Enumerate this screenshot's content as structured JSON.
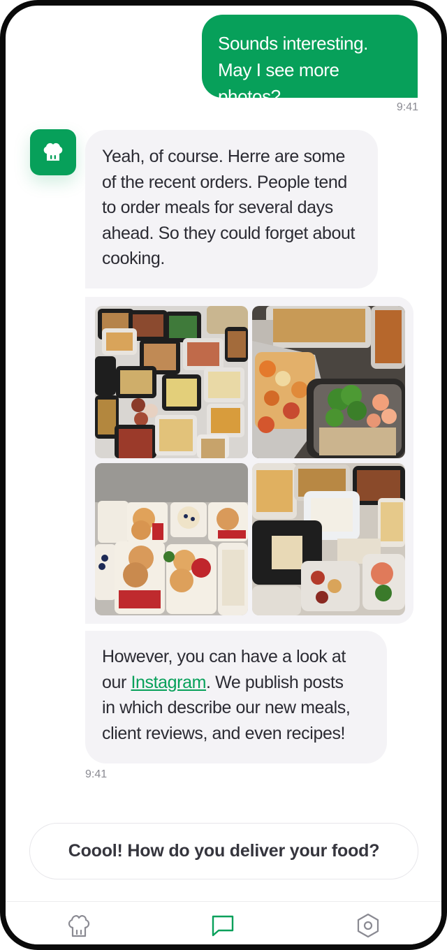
{
  "messages": {
    "outgoing": {
      "line1": "Sounds interesting.",
      "line2": "May I see more photos?",
      "time": "9:41"
    },
    "incoming_first": {
      "lines": [
        "Yeah, of course. Herre are some",
        "of the recent orders. People tend",
        "to order meals for several days",
        "ahead. So they could forget about",
        "cooking."
      ]
    },
    "incoming_last": {
      "line1": "However, you can have a look at",
      "line2_prefix": "our ",
      "link": "Instagram",
      "line2_suffix": ". We publish posts",
      "line3": "in which describe our new meals,",
      "line4": "client reviews, and even recipes!",
      "time": "9:41"
    },
    "photos": [
      "meal-containers-photo",
      "baked-dishes-photo",
      "pancakes-photo",
      "mixed-meals-photo"
    ]
  },
  "suggestion": {
    "label": "Coool! How do you deliver your food?"
  },
  "tabbar": {
    "icons": [
      "chef-hat-icon",
      "chat-bubble-icon",
      "settings-hexagon-icon"
    ],
    "active": "chat"
  },
  "colors": {
    "accent": "#07a05a",
    "bubble_incoming": "#f4f3f6",
    "text": "#2b2b33",
    "muted": "#8a8a92"
  }
}
